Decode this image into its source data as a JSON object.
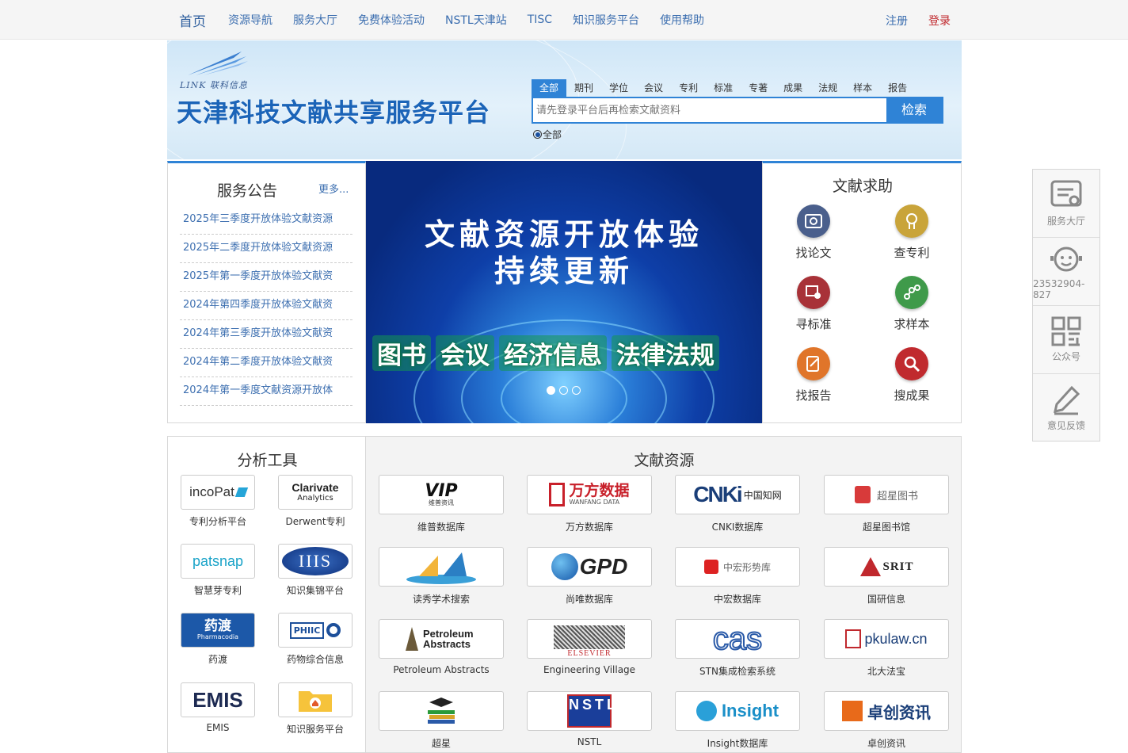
{
  "topnav": {
    "home": "首页",
    "items": [
      "资源导航",
      "服务大厅",
      "免费体验活动",
      "NSTL天津站",
      "TISC",
      "知识服务平台",
      "使用帮助"
    ],
    "register": "注册",
    "login": "登录"
  },
  "banner": {
    "logo_sub": "LINK 联科信息",
    "title": "天津科技文献共享服务平台"
  },
  "search": {
    "tabs": [
      "全部",
      "期刊",
      "学位",
      "会议",
      "专利",
      "标准",
      "专著",
      "成果",
      "法规",
      "样本",
      "报告"
    ],
    "placeholder": "请先登录平台后再检索文献资料",
    "button": "检索",
    "radio_label": "全部"
  },
  "notice": {
    "title": "服务公告",
    "more": "更多...",
    "items": [
      "2025年三季度开放体验文献资源",
      "2025年二季度开放体验文献资源",
      "2025年第一季度开放体验文献资",
      "2024年第四季度开放体验文献资",
      "2024年第三季度开放体验文献资",
      "2024年第二季度开放体验文献资",
      "2024年第一季度文献资源开放体"
    ]
  },
  "slider": {
    "line1": "文献资源开放体验",
    "line2": "持续更新",
    "categories": [
      "图书",
      "会议",
      "经济信息",
      "法律法规"
    ]
  },
  "help": {
    "title": "文献求助",
    "items": [
      {
        "label": "找论文",
        "icon": "paper-icon",
        "color": "#4a5f8c"
      },
      {
        "label": "查专利",
        "icon": "patent-icon",
        "color": "#c9a43a"
      },
      {
        "label": "寻标准",
        "icon": "standard-icon",
        "color": "#a83238"
      },
      {
        "label": "求样本",
        "icon": "sample-icon",
        "color": "#3f9a4a"
      },
      {
        "label": "找报告",
        "icon": "report-icon",
        "color": "#e0752a"
      },
      {
        "label": "搜成果",
        "icon": "search-result-icon",
        "color": "#c02a2e"
      }
    ]
  },
  "tools": {
    "title": "分析工具",
    "items": [
      {
        "logo": "incoPat",
        "label": "专利分析平台"
      },
      {
        "logo": "Clarivate",
        "logo_sub": "Analytics",
        "label": "Derwent专利"
      },
      {
        "logo": "patsnap",
        "label": "智慧芽专利"
      },
      {
        "logo": "IIIS",
        "label": "知识集锦平台"
      },
      {
        "logo": "药渡",
        "logo_sub": "Pharmacodia",
        "label": "药渡"
      },
      {
        "logo": "PHIIC",
        "label": "药物综合信息"
      },
      {
        "logo": "EMIS",
        "label": "EMIS"
      },
      {
        "logo": "",
        "label": "知识服务平台"
      }
    ]
  },
  "resources": {
    "title": "文献资源",
    "items": [
      {
        "logo": "VIP",
        "logo_sub": "维普资讯",
        "label": "维普数据库"
      },
      {
        "logo": "万方数据",
        "logo_sub": "WANFANG DATA",
        "label": "万方数据库"
      },
      {
        "logo": "CNKi",
        "logo_sub": "中国知网",
        "label": "CNKI数据库"
      },
      {
        "logo": "超星图书",
        "label": "超星图书馆"
      },
      {
        "logo": "",
        "label": "读秀学术搜索"
      },
      {
        "logo": "GPD",
        "label": "尚唯数据库"
      },
      {
        "logo": "中宏形势库",
        "label": "中宏数据库"
      },
      {
        "logo": "SRIT",
        "label": "国研信息"
      },
      {
        "logo": "Petroleum Abstracts",
        "label": "Petroleum Abstracts"
      },
      {
        "logo": "ELSEVIER",
        "label": "Engineering Village"
      },
      {
        "logo": "cas",
        "label": "STN集成检索系统"
      },
      {
        "logo": "pkulaw.cn",
        "label": "北大法宝"
      },
      {
        "logo": "",
        "label": "超星"
      },
      {
        "logo": "NSTL",
        "label": "NSTL"
      },
      {
        "logo": "Insight",
        "label": "Insight数据库"
      },
      {
        "logo": "卓创资讯",
        "label": "卓创资讯"
      }
    ]
  },
  "float": {
    "items": [
      {
        "label": "服务大厅",
        "icon": "service-hall-icon"
      },
      {
        "label": "23532904-827",
        "icon": "customer-service-icon"
      },
      {
        "label": "公众号",
        "icon": "qr-code-icon"
      },
      {
        "label": "意见反馈",
        "icon": "feedback-icon"
      }
    ]
  },
  "colors": {
    "accent": "#2f83d6",
    "link": "#3d6fb0",
    "login": "#c0282d"
  }
}
